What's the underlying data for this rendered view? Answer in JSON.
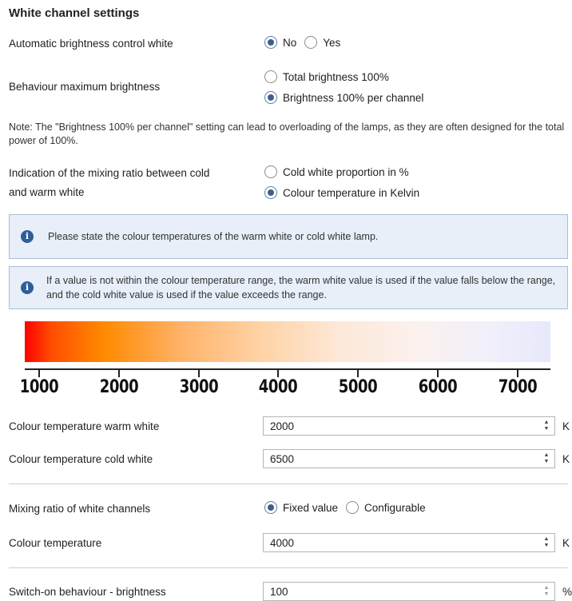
{
  "section_title": "White channel settings",
  "auto_brightness": {
    "label": "Automatic brightness control white",
    "options": [
      "No",
      "Yes"
    ],
    "selected": "No"
  },
  "behaviour_max_brightness": {
    "label": "Behaviour maximum brightness",
    "options": [
      "Total brightness 100%",
      "Brightness 100% per channel"
    ],
    "selected": "Brightness 100% per channel"
  },
  "note_text": "Note: The \"Brightness 100% per channel\" setting can lead to overloading of the lamps, as they are often designed for the total power of 100%.",
  "mixing_indication": {
    "label_line1": "Indication of the mixing ratio between cold",
    "label_line2": "and warm white",
    "options": [
      "Cold white proportion in %",
      "Colour temperature in Kelvin"
    ],
    "selected": "Colour temperature in Kelvin"
  },
  "info_1": "Please state the colour temperatures of the warm white or cold white lamp.",
  "info_2": "If a value is not within the colour temperature range, the warm white value is used if the value falls below the range, and the cold white value is used if the value exceeds the range.",
  "scale": {
    "ticks": [
      "1000",
      "2000",
      "3000",
      "4000",
      "5000",
      "6000",
      "7000"
    ]
  },
  "warm_white": {
    "label": "Colour temperature warm white",
    "value": "2000",
    "unit": "K"
  },
  "cold_white": {
    "label": "Colour temperature cold white",
    "value": "6500",
    "unit": "K"
  },
  "mixing_ratio": {
    "label": "Mixing ratio of white channels",
    "options": [
      "Fixed value",
      "Configurable"
    ],
    "selected": "Fixed value"
  },
  "colour_temperature": {
    "label": "Colour temperature",
    "value": "4000",
    "unit": "K"
  },
  "switch_on": {
    "label": "Switch-on behaviour - brightness",
    "value": "100",
    "unit": "%"
  },
  "colors": {
    "accent": "#3f5f87",
    "info_bg": "#e8eff8",
    "info_border": "#a8bfd8",
    "info_icon": "#2e5f96"
  },
  "icons": {
    "info": "info-icon",
    "spinner": "spinner-arrows-icon",
    "radio": "radio-button"
  }
}
